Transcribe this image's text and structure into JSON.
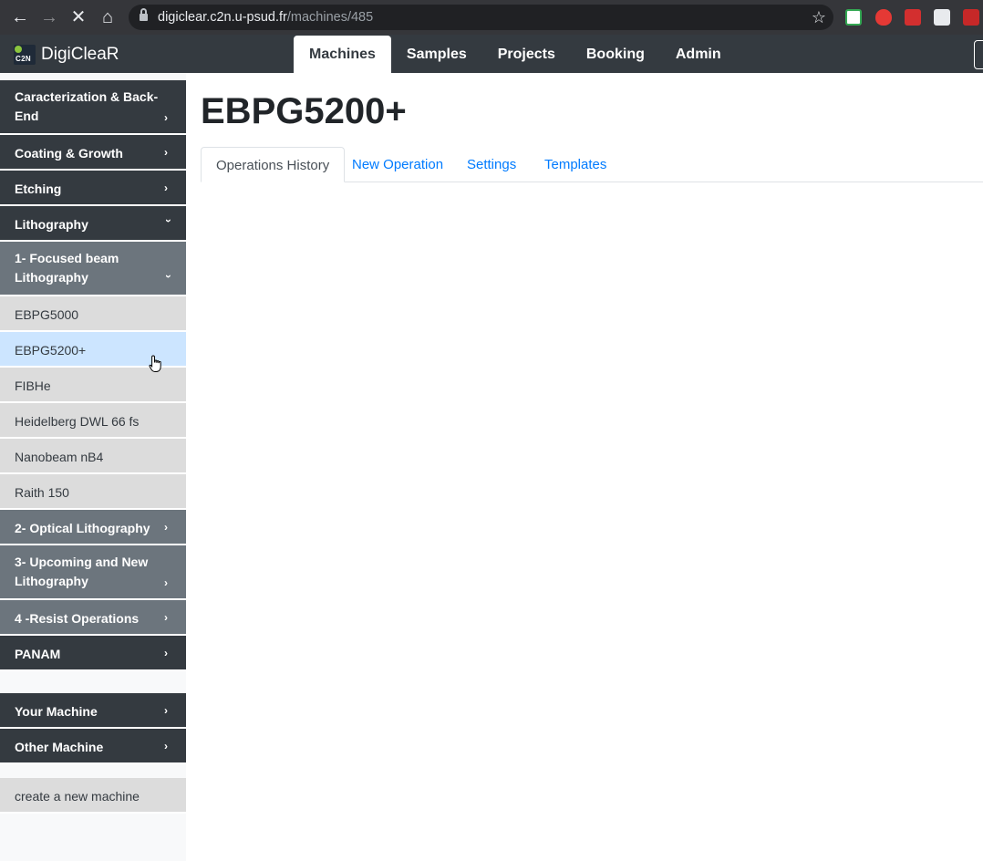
{
  "browser": {
    "url_host": "digiclear.c2n.u-psud.fr",
    "url_path": "/machines/485"
  },
  "app": {
    "brand_logo_text": "C2N",
    "brand_name": "DigiCleaR",
    "nav": [
      {
        "label": "Machines",
        "active": true
      },
      {
        "label": "Samples"
      },
      {
        "label": "Projects"
      },
      {
        "label": "Booking"
      },
      {
        "label": "Admin"
      }
    ]
  },
  "sidebar": {
    "categories": [
      {
        "label": "Caracterization & Back-End",
        "expanded": false
      },
      {
        "label": "Coating & Growth",
        "expanded": false
      },
      {
        "label": "Etching",
        "expanded": false
      },
      {
        "label": "Lithography",
        "expanded": true
      }
    ],
    "subcategories": [
      {
        "label": "1- Focused beam Lithography",
        "expanded": true
      },
      {
        "label": "2- Optical Lithography",
        "expanded": false
      },
      {
        "label": "3- Upcoming and New Lithography",
        "expanded": false
      },
      {
        "label": "4 -Resist Operations",
        "expanded": false
      }
    ],
    "machines": [
      {
        "label": "EBPG5000"
      },
      {
        "label": "EBPG5200+",
        "active": true
      },
      {
        "label": "FIBHe"
      },
      {
        "label": "Heidelberg DWL 66 fs"
      },
      {
        "label": "Nanobeam nB4"
      },
      {
        "label": "Raith 150"
      }
    ],
    "panam": "PANAM",
    "your_machine": "Your Machine",
    "other_machine": "Other Machine",
    "create_new": "create a new machine"
  },
  "main": {
    "title": "EBPG5200+",
    "tabs": [
      {
        "label": "Operations History",
        "active": true
      },
      {
        "label": "New Operation"
      },
      {
        "label": "Settings"
      },
      {
        "label": "Templates"
      }
    ]
  },
  "colors": {
    "navbar": "#343a40",
    "subcategory": "#6c757d",
    "active_item": "#cce5ff",
    "link": "#007bff"
  }
}
